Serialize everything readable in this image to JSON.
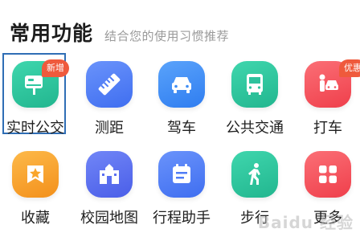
{
  "header": {
    "title": "常用功能",
    "subtitle": "结合您的使用习惯推荐"
  },
  "functions": [
    {
      "label": "实时公交",
      "icon": "bus-stop-icon",
      "color": "#2fc7a0",
      "badge": "新增",
      "selected": true
    },
    {
      "label": "测距",
      "icon": "ruler-icon",
      "color": "#4f7cf6",
      "badge": ""
    },
    {
      "label": "驾车",
      "icon": "car-icon",
      "color": "#3f8ef5",
      "badge": ""
    },
    {
      "label": "公共交通",
      "icon": "bus-icon",
      "color": "#2ec29d",
      "badge": ""
    },
    {
      "label": "打车",
      "icon": "taxi-icon",
      "color": "#f5525c",
      "badge": "优惠"
    },
    {
      "label": "收藏",
      "icon": "star-icon",
      "color": "#f9a52b",
      "badge": ""
    },
    {
      "label": "校园地图",
      "icon": "school-icon",
      "color": "#5a6ff0",
      "badge": ""
    },
    {
      "label": "行程助手",
      "icon": "calendar-icon",
      "color": "#4f7cf6",
      "badge": ""
    },
    {
      "label": "步行",
      "icon": "walk-icon",
      "color": "#2fc79a",
      "badge": ""
    },
    {
      "label": "更多",
      "icon": "grid-icon",
      "color": "#f5525c",
      "badge": ""
    }
  ],
  "watermark": "Baidu 经验"
}
